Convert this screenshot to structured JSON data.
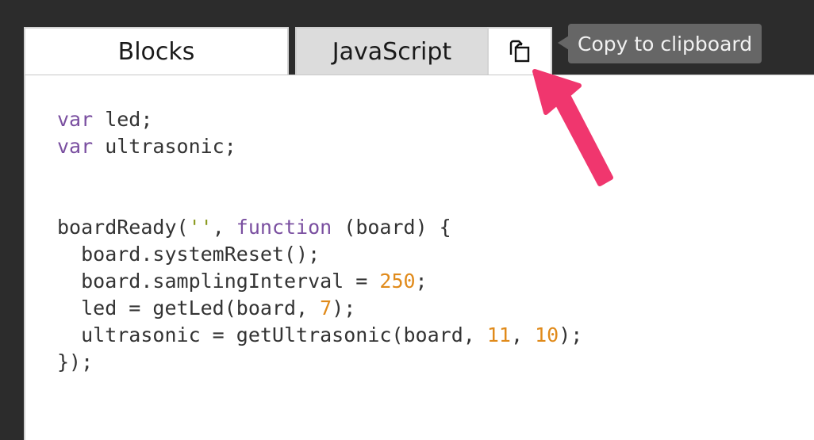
{
  "tabs": {
    "blocks_label": "Blocks",
    "javascript_label": "JavaScript",
    "active": "JavaScript"
  },
  "copy_button": {
    "icon": "copy-icon",
    "tooltip": "Copy to clipboard"
  },
  "code": {
    "lines": [
      [
        {
          "t": "var",
          "c": "kw"
        },
        {
          "t": " led;",
          "c": ""
        }
      ],
      [
        {
          "t": "var",
          "c": "kw"
        },
        {
          "t": " ultrasonic;",
          "c": ""
        }
      ],
      [],
      [],
      [
        {
          "t": "boardReady(",
          "c": ""
        },
        {
          "t": "''",
          "c": "str"
        },
        {
          "t": ", ",
          "c": ""
        },
        {
          "t": "function",
          "c": "kw"
        },
        {
          "t": " (board) {",
          "c": ""
        }
      ],
      [
        {
          "t": "  board.systemReset();",
          "c": ""
        }
      ],
      [
        {
          "t": "  board.samplingInterval = ",
          "c": ""
        },
        {
          "t": "250",
          "c": "num"
        },
        {
          "t": ";",
          "c": ""
        }
      ],
      [
        {
          "t": "  led = getLed(board, ",
          "c": ""
        },
        {
          "t": "7",
          "c": "num"
        },
        {
          "t": ");",
          "c": ""
        }
      ],
      [
        {
          "t": "  ultrasonic = getUltrasonic(board, ",
          "c": ""
        },
        {
          "t": "11",
          "c": "num"
        },
        {
          "t": ", ",
          "c": ""
        },
        {
          "t": "10",
          "c": "num"
        },
        {
          "t": ");",
          "c": ""
        }
      ],
      [
        {
          "t": "});",
          "c": ""
        }
      ]
    ]
  },
  "colors": {
    "keyword": "#7a4fa0",
    "string": "#8a9a1f",
    "number": "#e08a1a",
    "annotation_arrow": "#f0366e",
    "tooltip_bg": "#666666"
  }
}
